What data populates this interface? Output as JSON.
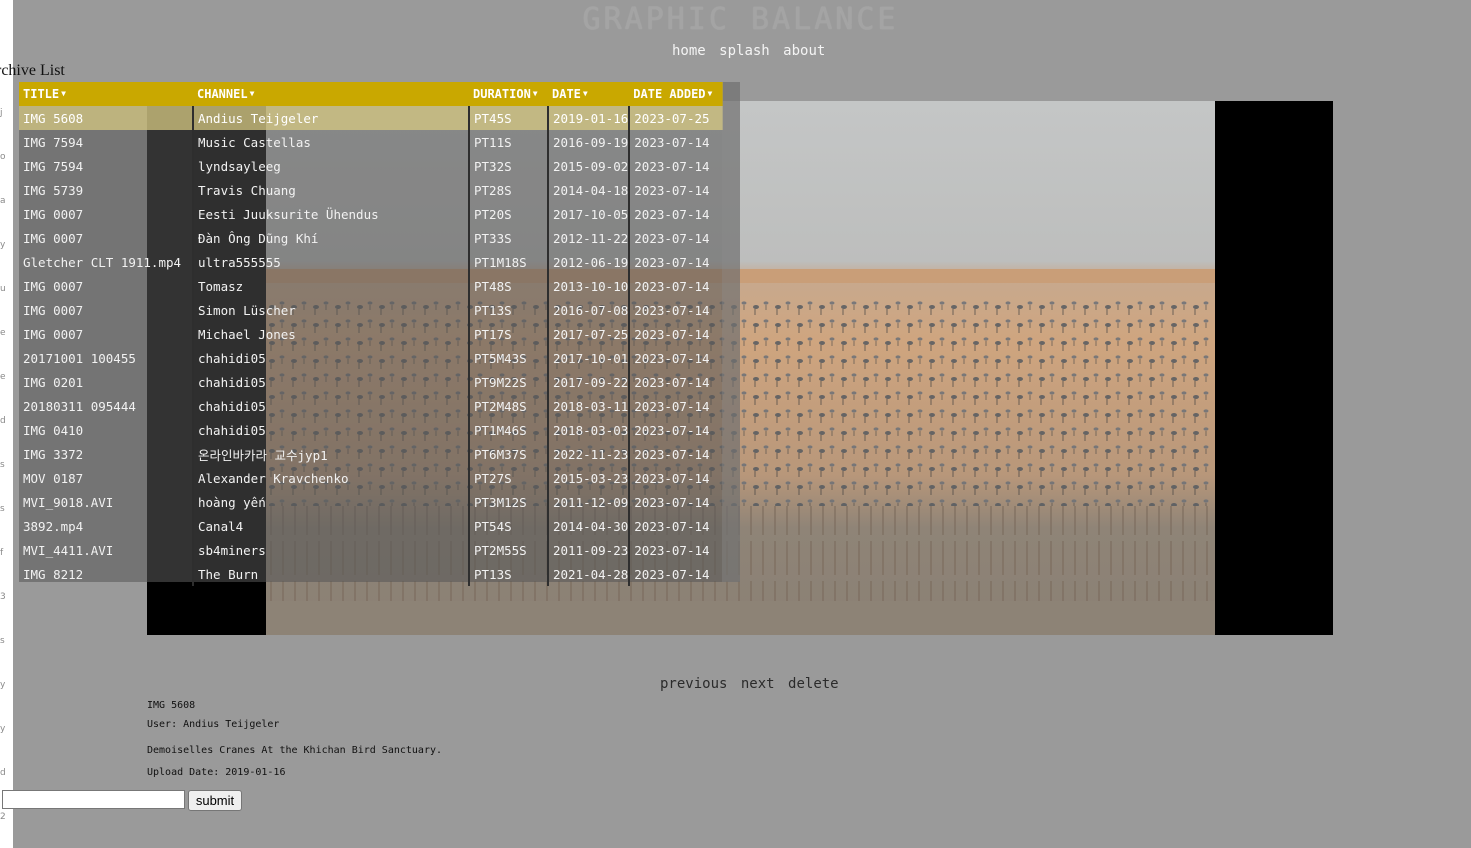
{
  "site": {
    "title": "GRAPHIC BALANCE"
  },
  "nav": {
    "home": "home",
    "splash": "splash",
    "about": "about"
  },
  "archive": {
    "heading": "rchive List"
  },
  "table": {
    "columns": [
      "TITLE",
      "CHANNEL",
      "DURATION",
      "DATE",
      "DATE ADDED"
    ],
    "rows": [
      {
        "title": "IMG 5608",
        "channel": "Andius Teijgeler",
        "duration": "PT45S",
        "date": "2019-01-16",
        "added": "2023-07-25"
      },
      {
        "title": "IMG 7594",
        "channel": "Music Castellas",
        "duration": "PT11S",
        "date": "2016-09-19",
        "added": "2023-07-14"
      },
      {
        "title": "IMG 7594",
        "channel": "lyndsayleeg",
        "duration": "PT32S",
        "date": "2015-09-02",
        "added": "2023-07-14"
      },
      {
        "title": "IMG 5739",
        "channel": "Travis Chuang",
        "duration": "PT28S",
        "date": "2014-04-18",
        "added": "2023-07-14"
      },
      {
        "title": "IMG 0007",
        "channel": "Eesti Juuksurite Ühendus",
        "duration": "PT20S",
        "date": "2017-10-05",
        "added": "2023-07-14"
      },
      {
        "title": "IMG 0007",
        "channel": "Đàn Ông Dũng Khí",
        "duration": "PT33S",
        "date": "2012-11-22",
        "added": "2023-07-14"
      },
      {
        "title": "Gletcher CLT 1911.mp4",
        "channel": "ultra555555",
        "duration": "PT1M18S",
        "date": "2012-06-19",
        "added": "2023-07-14"
      },
      {
        "title": "IMG 0007",
        "channel": "Tomasz",
        "duration": "PT48S",
        "date": "2013-10-10",
        "added": "2023-07-14"
      },
      {
        "title": "IMG 0007",
        "channel": "Simon Lüscher",
        "duration": "PT13S",
        "date": "2016-07-08",
        "added": "2023-07-14"
      },
      {
        "title": "IMG 0007",
        "channel": "Michael Jones",
        "duration": "PT17S",
        "date": "2017-07-25",
        "added": "2023-07-14"
      },
      {
        "title": "20171001 100455",
        "channel": "chahidi05",
        "duration": "PT5M43S",
        "date": "2017-10-01",
        "added": "2023-07-14"
      },
      {
        "title": "IMG 0201",
        "channel": "chahidi05",
        "duration": "PT9M22S",
        "date": "2017-09-22",
        "added": "2023-07-14"
      },
      {
        "title": "20180311 095444",
        "channel": "chahidi05",
        "duration": "PT2M48S",
        "date": "2018-03-11",
        "added": "2023-07-14"
      },
      {
        "title": "IMG 0410",
        "channel": "chahidi05",
        "duration": "PT1M46S",
        "date": "2018-03-03",
        "added": "2023-07-14"
      },
      {
        "title": "IMG 3372",
        "channel": "온라인바카라 교수jyp1",
        "duration": "PT6M37S",
        "date": "2022-11-23",
        "added": "2023-07-14"
      },
      {
        "title": "MOV 0187",
        "channel": "Alexander Kravchenko",
        "duration": "PT27S",
        "date": "2015-03-23",
        "added": "2023-07-14"
      },
      {
        "title": "MVI_9018.AVI",
        "channel": "hoàng yến",
        "duration": "PT3M12S",
        "date": "2011-12-09",
        "added": "2023-07-14"
      },
      {
        "title": "3892.mp4",
        "channel": "Canal4",
        "duration": "PT54S",
        "date": "2014-04-30",
        "added": "2023-07-14"
      },
      {
        "title": "MVI_4411.AVI",
        "channel": "sb4miners",
        "duration": "PT2M55S",
        "date": "2011-09-23",
        "added": "2023-07-14"
      },
      {
        "title": "IMG 8212",
        "channel": "The Burn",
        "duration": "PT13S",
        "date": "2021-04-28",
        "added": "2023-07-14"
      }
    ]
  },
  "controls": {
    "previous": "previous",
    "next": "next",
    "delete": "delete"
  },
  "details": {
    "title": "IMG 5608",
    "user": "User: Andius Teijgeler",
    "description": "Demoiselles Cranes At the Khichan Bird Sanctuary.",
    "upload": "Upload Date: 2019-01-16"
  },
  "form": {
    "input_value": "",
    "submit_label": "submit"
  },
  "left_strip": {
    "letters": [
      "j",
      "o",
      "a",
      "y",
      "u",
      "e",
      "e",
      "d",
      "s",
      "s",
      "f",
      "3",
      "s",
      "y",
      "y",
      "d",
      "2"
    ]
  },
  "colors": {
    "header_bg": "#c9a800",
    "page_bg": "#9a9a9a",
    "active_row": "#d6c882"
  }
}
